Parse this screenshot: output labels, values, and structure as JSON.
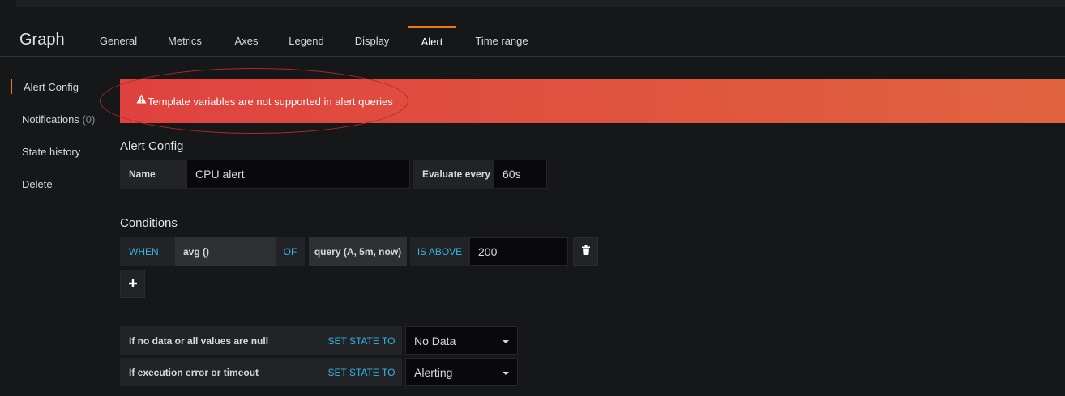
{
  "panel": {
    "title": "Graph"
  },
  "tabs": [
    {
      "label": "General"
    },
    {
      "label": "Metrics"
    },
    {
      "label": "Axes"
    },
    {
      "label": "Legend"
    },
    {
      "label": "Display"
    },
    {
      "label": "Alert"
    },
    {
      "label": "Time range"
    }
  ],
  "active_tab": "Alert",
  "sidebar": {
    "items": [
      {
        "label": "Alert Config"
      },
      {
        "label": "Notifications",
        "count": "(0)"
      },
      {
        "label": "State history"
      },
      {
        "label": "Delete"
      }
    ]
  },
  "error": {
    "icon": "warning-icon",
    "message": "Template variables are not supported in alert queries"
  },
  "alert_config": {
    "heading": "Alert Config",
    "name_label": "Name",
    "name_value": "CPU alert",
    "evaluate_label": "Evaluate every",
    "evaluate_value": "60s"
  },
  "conditions": {
    "heading": "Conditions",
    "when": "WHEN",
    "reducer": "avg ()",
    "of": "OF",
    "query": "query (A, 5m, now)",
    "evaluator": "IS ABOVE",
    "threshold": "200",
    "delete_icon": "trash-icon",
    "add_icon": "plus-icon"
  },
  "state_rules": [
    {
      "condition": "If no data or all values are null",
      "action": "SET STATE TO",
      "value": "No Data"
    },
    {
      "condition": "If execution error or timeout",
      "action": "SET STATE TO",
      "value": "Alerting"
    }
  ],
  "colors": {
    "accent": "#eb7b18",
    "error": "#e0423f",
    "keyword": "#33b5e5"
  }
}
